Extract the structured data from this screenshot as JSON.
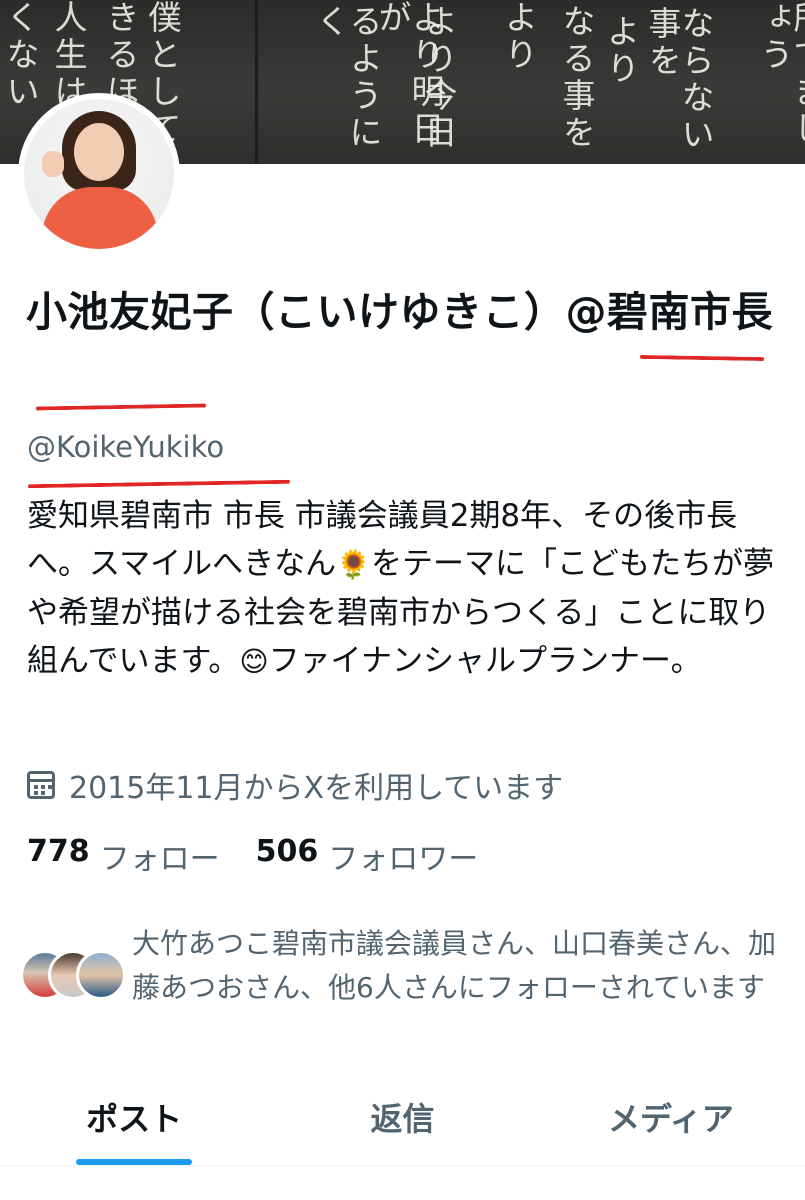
{
  "banner": {
    "chalk_columns": [
      "所でましょう",
      "ならない事を",
      "より",
      "なる事を",
      "より今日",
      "より明日が",
      "るようにく",
      "より",
      "僕として",
      "きるほど",
      "人生は",
      "くない"
    ]
  },
  "profile": {
    "display_name": "小池友妃子（こいけゆきこ）@碧南市長",
    "handle": "@KoikeYukiko",
    "bio_part1": "愛知県碧南市 市長 市議会議員2期8年、その後市長へ。スマイルへきなん",
    "bio_emoji1": "🌻",
    "bio_part2": "をテーマに「こどもたちが夢や希望が描ける社会を碧南市からつくる」ことに取り組んでいます。",
    "bio_emoji2": "😊",
    "bio_part3": "ファイナンシャルプランナー。",
    "joined": "2015年11月からXを利用しています",
    "following_count": "778",
    "following_label": "フォロー",
    "followers_count": "506",
    "followers_label": "フォロワー",
    "known_followers": "大竹あつこ碧南市議会議員さん、山口春美さん、加藤あつおさん、他6人さんにフォローされています"
  },
  "icons": {
    "calendar": "calendar-icon"
  },
  "colors": {
    "accent": "#1d9bf0",
    "annotation": "#e02626",
    "secondary_text": "#536471"
  },
  "tabs": [
    {
      "label": "ポスト",
      "active": true
    },
    {
      "label": "返信",
      "active": false
    },
    {
      "label": "メディア",
      "active": false
    }
  ]
}
